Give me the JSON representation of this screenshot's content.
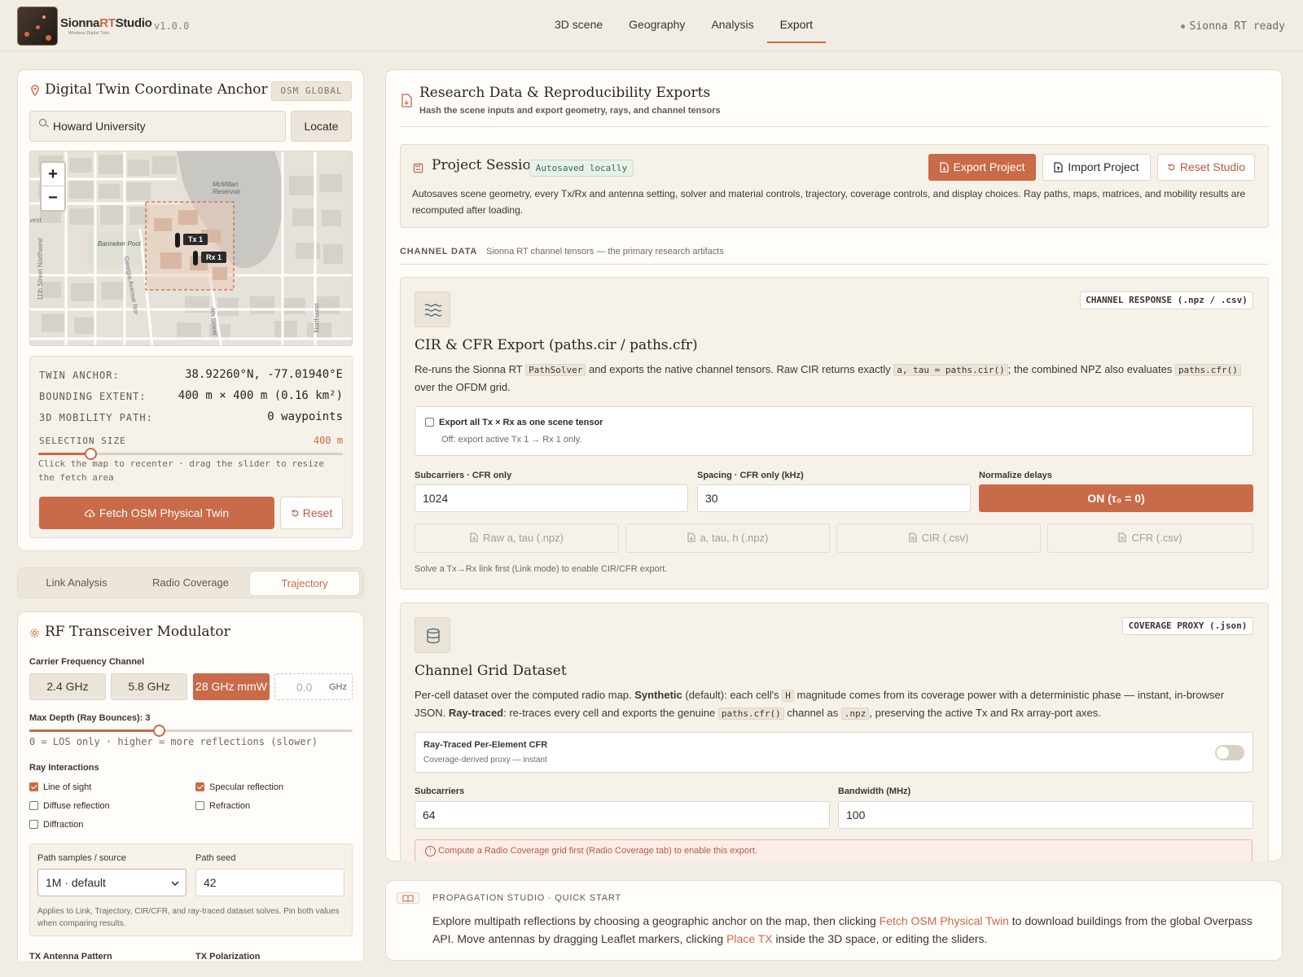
{
  "app": {
    "brand_a": "Sionna",
    "brand_b": "RT",
    "brand_c": "Studio",
    "brand_sub": "Wireless Digital Twin",
    "version": "v1.0.0",
    "status": "Sionna RT ready"
  },
  "nav": {
    "tabs": [
      "3D scene",
      "Geography",
      "Analysis",
      "Export"
    ],
    "active": "Export"
  },
  "anchor": {
    "title": "Digital Twin Coordinate Anchor",
    "badge": "OSM GLOBAL",
    "search_value": "Howard University",
    "locate": "Locate",
    "map_labels": {
      "reservoir_1": "McMillan",
      "reservoir_2": "Reservoir",
      "pool": "Banneker Pool",
      "street_ga": "Georgia Avenue Nor",
      "street_11": "11th Street Northwest",
      "street_4": "4th Street",
      "street_nw": "Northwest",
      "vest": "vest"
    },
    "tx_label": "Tx 1",
    "rx_label": "Rx 1",
    "twin_anchor_label": "TWIN ANCHOR:",
    "twin_anchor_value": "38.92260°N, -77.01940°E",
    "bounding_label": "BOUNDING EXTENT:",
    "bounding_value": "400 m × 400 m (0.16 km²)",
    "path_label": "3D MOBILITY PATH:",
    "path_value": "0 waypoints",
    "selection_label": "SELECTION SIZE",
    "selection_value": "400 m",
    "selection_fraction": 0.17,
    "hint": "Click the map to recenter · drag the slider to resize the fetch area",
    "fetch": "Fetch OSM Physical Twin",
    "reset": "Reset"
  },
  "subtabs": {
    "items": [
      "Link Analysis",
      "Radio Coverage",
      "Trajectory"
    ],
    "active": "Trajectory"
  },
  "rf": {
    "title": "RF Transceiver Modulator",
    "carrier_label": "Carrier Frequency Channel",
    "bands": [
      "2.4 GHz",
      "5.8 GHz",
      "28 GHz mmW"
    ],
    "active_band": "28 GHz mmW",
    "custom_placeholder": "0.0",
    "unit": "GHz",
    "depth_label": "Max Depth (Ray Bounces): 3",
    "depth_fraction": 0.4,
    "depth_hint": "0 = LOS only · higher = more reflections (slower)",
    "interactions_label": "Ray Interactions",
    "interactions": [
      {
        "label": "Line of sight",
        "checked": true
      },
      {
        "label": "Specular reflection",
        "checked": true
      },
      {
        "label": "Diffuse reflection",
        "checked": false
      },
      {
        "label": "Refraction",
        "checked": false
      },
      {
        "label": "Diffraction",
        "checked": false
      }
    ],
    "samples_label": "Path samples / source",
    "samples_value": "1M · default",
    "seed_label": "Path seed",
    "seed_value": "42",
    "samples_hint": "Applies to Link, Trajectory, CIR/CFR, and ray-traced dataset solves. Pin both values when comparing results.",
    "tx_pattern": "TX Antenna Pattern",
    "tx_pol": "TX Polarization"
  },
  "exports": {
    "title": "Research Data & Reproducibility Exports",
    "subtitle": "Hash the scene inputs and export geometry, rays, and channel tensors",
    "session": {
      "title": "Project Session",
      "autosaved": "Autosaved locally",
      "export": "Export Project",
      "import": "Import Project",
      "reset": "Reset Studio",
      "desc": "Autosaves scene geometry, every Tx/Rx and antenna setting, solver and material controls, trajectory, coverage controls, and display choices. Ray paths, maps, matrices, and mobility results are recomputed after loading."
    },
    "channel_data_label": "CHANNEL DATA",
    "channel_data_sub": "Sionna RT channel tensors — the primary research artifacts",
    "cir": {
      "tag": "CHANNEL RESPONSE (.npz / .csv)",
      "title": "CIR & CFR Export (paths.cir / paths.cfr)",
      "d1": "Re-runs the Sionna RT",
      "c1": "PathSolver",
      "d2": "and exports the native channel tensors. Raw CIR returns exactly",
      "c2": "a, tau = paths.cir()",
      "d3": "; the combined NPZ also evaluates",
      "c3": "paths.cfr()",
      "d4": "over the OFDM grid.",
      "all_label": "Export all Tx × Rx as one scene tensor",
      "all_hint": "Off: export active Tx 1 → Rx 1 only.",
      "subcarriers_label": "Subcarriers · CFR only",
      "subcarriers_value": "1024",
      "spacing_label": "Spacing · CFR only (kHz)",
      "spacing_value": "30",
      "normalize_label": "Normalize delays",
      "normalize_value": "ON (τ₀ = 0)",
      "downloads": [
        "Raw a, tau (.npz)",
        "a, tau, h (.npz)",
        "CIR (.csv)",
        "CFR (.csv)"
      ],
      "note": "Solve a Tx→Rx link first (Link mode) to enable CIR/CFR export."
    },
    "grid": {
      "tag": "COVERAGE PROXY (.json)",
      "title": "Channel Grid Dataset",
      "d1": "Per-cell dataset over the computed radio map.",
      "b1": "Synthetic",
      "d2": "(default): each cell's",
      "c1": "H",
      "d3": "magnitude comes from its coverage power with a deterministic phase — instant, in-browser JSON.",
      "b2": "Ray-traced",
      "d4": ": re-traces every cell and exports the genuine",
      "c2": "paths.cfr()",
      "d5": "channel as",
      "c3": ".npz",
      "d6": ", preserving the active Tx and Rx array-port axes.",
      "rt_label": "Ray-Traced Per-Element CFR",
      "rt_hint": "Coverage-derived proxy — instant",
      "subcarriers_label": "Subcarriers",
      "subcarriers_value": "64",
      "bandwidth_label": "Bandwidth (MHz)",
      "bandwidth_value": "100",
      "error": "Compute a Radio Coverage grid first (Radio Coverage tab) to enable this export."
    }
  },
  "quickstart": {
    "title": "PROPAGATION STUDIO · QUICK START",
    "t1": "Explore multipath reflections by choosing a geographic anchor on the map, then clicking",
    "l1": "Fetch OSM Physical Twin",
    "t2": "to download buildings from the global Overpass API. Move antennas by dragging Leaflet markers, clicking",
    "l2": "Place TX",
    "t3": "inside the 3D space, or editing the sliders."
  }
}
